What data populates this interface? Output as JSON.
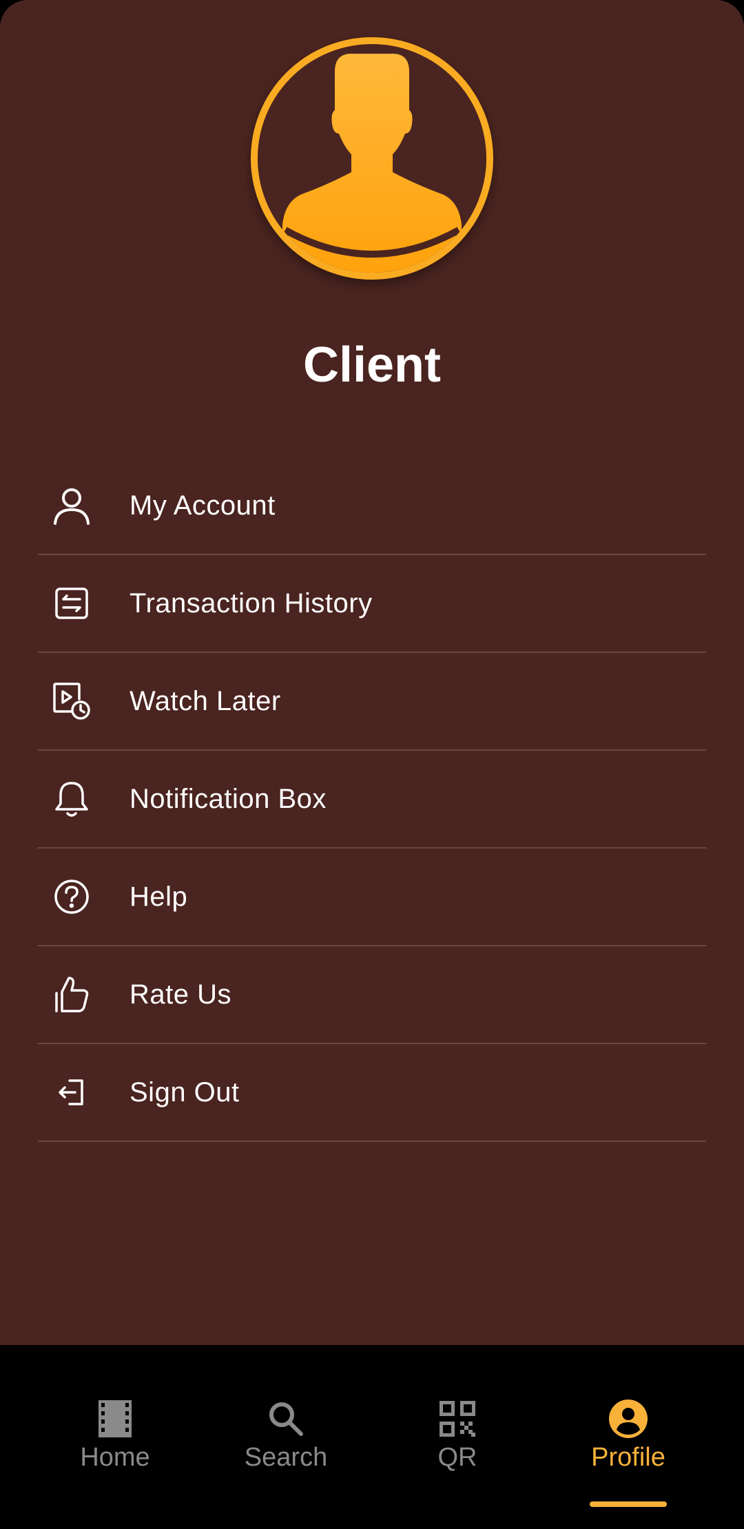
{
  "profile": {
    "name": "Client",
    "avatar_icon": "person-silhouette-icon"
  },
  "menu": [
    {
      "label": "My Account",
      "icon": "person-outline-icon"
    },
    {
      "label": "Transaction History",
      "icon": "transaction-icon"
    },
    {
      "label": "Watch Later",
      "icon": "watch-later-icon"
    },
    {
      "label": "Notification Box",
      "icon": "bell-icon"
    },
    {
      "label": "Help",
      "icon": "help-circle-icon"
    },
    {
      "label": "Rate Us",
      "icon": "thumbs-up-icon"
    },
    {
      "label": "Sign Out",
      "icon": "sign-out-icon"
    }
  ],
  "nav": [
    {
      "label": "Home",
      "icon": "film-icon",
      "active": false
    },
    {
      "label": "Search",
      "icon": "search-icon",
      "active": false
    },
    {
      "label": "QR",
      "icon": "qr-code-icon",
      "active": false
    },
    {
      "label": "Profile",
      "icon": "account-circle-icon",
      "active": true
    }
  ],
  "colors": {
    "background": "#4a2420",
    "accent": "#f9b13a",
    "nav_background": "#000000",
    "nav_inactive": "#8a8a8a",
    "divider": "#6e4540"
  }
}
